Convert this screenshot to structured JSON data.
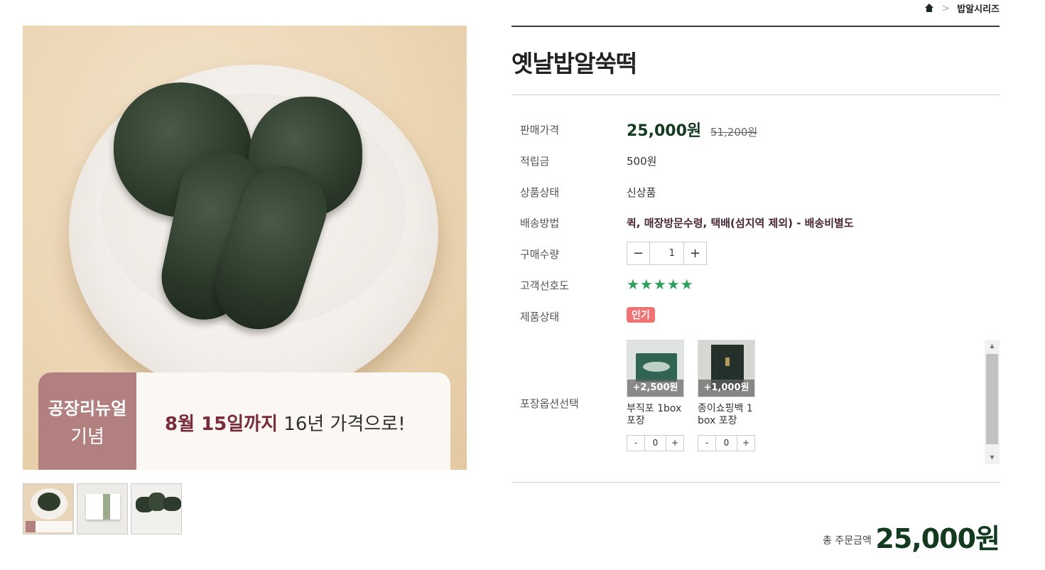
{
  "breadcrumb": {
    "home_icon": "home-icon",
    "separator": ">",
    "current": "밥알시리즈"
  },
  "product": {
    "title": "옛날밥알쑥떡",
    "banner": {
      "left_line1": "공장리뉴얼",
      "left_line2": "기념",
      "highlight": "8월 15일까지",
      "rest": "16년 가격으로!"
    }
  },
  "info": {
    "price_label": "판매가격",
    "price": "25,000원",
    "old_price": "51,200원",
    "points_label": "적립금",
    "points": "500원",
    "condition_label": "상품상태",
    "condition": "신상품",
    "shipping_label": "배송방법",
    "shipping": "퀵, 매장방문수령, 택배(섬지역 제외) - 배송비별도",
    "qty_label": "구매수량",
    "qty_minus": "−",
    "qty_value": "1",
    "qty_plus": "+",
    "rating_label": "고객선호도",
    "rating": "★★★★★",
    "rating_value": 5,
    "status_label": "제품상태",
    "status_badge": "인기",
    "package_label": "포장옵션선택"
  },
  "options": [
    {
      "add_price": "+2,500원",
      "name": "부직포 1box 포장",
      "minus": "-",
      "value": "0",
      "plus": "+"
    },
    {
      "add_price": "+1,000원",
      "name": "종이쇼핑백 1box 포장",
      "minus": "-",
      "value": "0",
      "plus": "+"
    }
  ],
  "scrollbar": {
    "up": "▲",
    "down": "▼"
  },
  "total": {
    "label": "총 주문금액",
    "amount": "25,000원"
  },
  "colors": {
    "price": "#123a1f",
    "badge": "#f07272",
    "stars": "#2aa05a",
    "banner_accent": "#b2807e"
  }
}
